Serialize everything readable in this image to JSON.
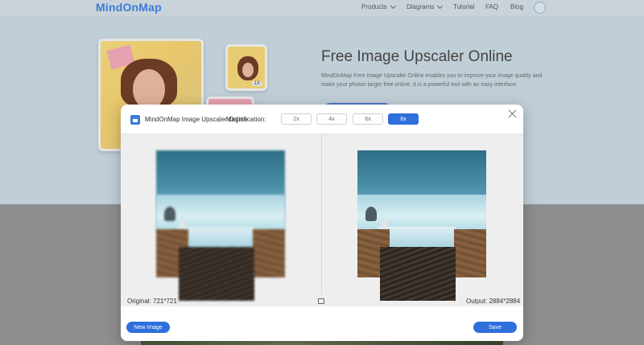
{
  "nav": {
    "logo": "MindOnMap",
    "items": [
      {
        "label": "Products",
        "dropdown": true
      },
      {
        "label": "Diagrams",
        "dropdown": true
      },
      {
        "label": "Tutorial",
        "dropdown": false
      },
      {
        "label": "FAQ",
        "dropdown": false
      },
      {
        "label": "Blog",
        "dropdown": false
      }
    ]
  },
  "hero": {
    "title": "Free Image Upscaler Online",
    "description": "MindOnMap Free Image Upscaler Online enables you to improve your image quality and make your photos larger free online. It is a powerful tool with an easy interface.",
    "sample_badge": "1X"
  },
  "modal": {
    "app_title": "MindOnMap Image Upscaler Online",
    "magnification_label": "Magnification:",
    "magnification_options": [
      "2x",
      "4x",
      "6x",
      "8x"
    ],
    "selected_magnification": "8x",
    "original_label": "Original: 721*721",
    "output_label": "Output: 2884*2884",
    "new_image_label": "New Image",
    "save_label": "Save"
  },
  "colors": {
    "accent": "#2f6fdc",
    "hero_bg": "#c0ced7",
    "overlay_bg": "#8e8e8e"
  }
}
